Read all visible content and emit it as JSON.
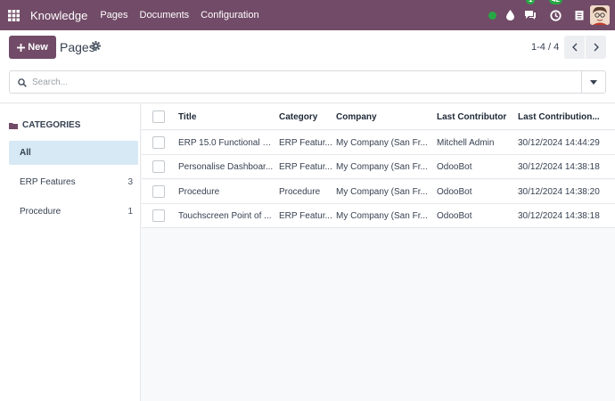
{
  "navbar": {
    "brand": "Knowledge",
    "menus": [
      "Pages",
      "Documents",
      "Configuration"
    ],
    "messages_badge": "1",
    "activities_badge": "42"
  },
  "control": {
    "new_label": "New",
    "title": "Pages",
    "pager": "1-4 / 4",
    "search_placeholder": "Search..."
  },
  "sidebar": {
    "heading": "CATEGORIES",
    "items": [
      {
        "label": "All",
        "count": ""
      },
      {
        "label": "ERP Features",
        "count": "3"
      },
      {
        "label": "Procedure",
        "count": "1"
      }
    ]
  },
  "list": {
    "columns": [
      "Title",
      "Category",
      "Company",
      "Last Contributor",
      "Last Contribution..."
    ],
    "rows": [
      {
        "title": "ERP 15.0 Functional D...",
        "category": "ERP Featur...",
        "company": "My Company (San Fr...",
        "contributor": "Mitchell Admin",
        "date": "30/12/2024 14:44:29"
      },
      {
        "title": "Personalise Dashboar...",
        "category": "ERP Featur...",
        "company": "My Company (San Fr...",
        "contributor": "OdooBot",
        "date": "30/12/2024 14:38:18"
      },
      {
        "title": "Procedure",
        "category": "Procedure",
        "company": "My Company (San Fr...",
        "contributor": "OdooBot",
        "date": "30/12/2024 14:38:20"
      },
      {
        "title": "Touchscreen Point of ...",
        "category": "ERP Featur...",
        "company": "My Company (San Fr...",
        "contributor": "OdooBot",
        "date": "30/12/2024 14:38:18"
      }
    ]
  },
  "colors": {
    "brand": "#714b67",
    "active": "#d6e9f5",
    "badge": "#28a745"
  }
}
